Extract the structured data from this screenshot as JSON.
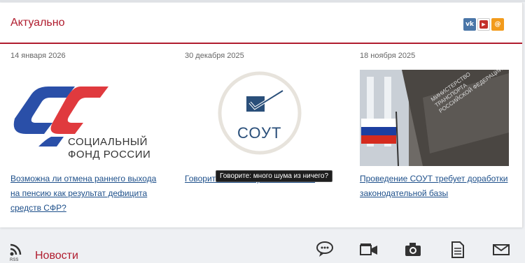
{
  "header": {
    "title": "Актуально"
  },
  "social": [
    {
      "name": "vk-icon",
      "label": "vk"
    },
    {
      "name": "youtube-icon",
      "label": "You Tube"
    },
    {
      "name": "email-icon",
      "label": "@"
    }
  ],
  "cards": [
    {
      "date": "14 января 2026",
      "logo_line1": "СОЦИАЛЬНЫЙ",
      "logo_line2": "ФОНД РОССИИ",
      "title": "Возможна ли отмена раннего выхода на пенсию как результат дефицита средств СФР?"
    },
    {
      "date": "30 декабря 2025",
      "logo_text": "СОУТ",
      "title": "Говорите: много шума из ничего?"
    },
    {
      "date": "18 ноября 2025",
      "photo_text": "МИНИСТЕРСТВО ТРАНСПОРТА РОССИЙСКОЙ ФЕДЕРАЦИИ",
      "title": "Проведение СОУТ требует доработки законодательной базы"
    }
  ],
  "tooltip": "Говорите: много шума из ничего?",
  "news": {
    "title": "Новости",
    "rss_label": "RSS"
  },
  "colors": {
    "accent": "#b01c2e",
    "link": "#1d4f8a",
    "sfr_blue": "#2a4fa8",
    "sfr_red": "#e03a3e"
  }
}
